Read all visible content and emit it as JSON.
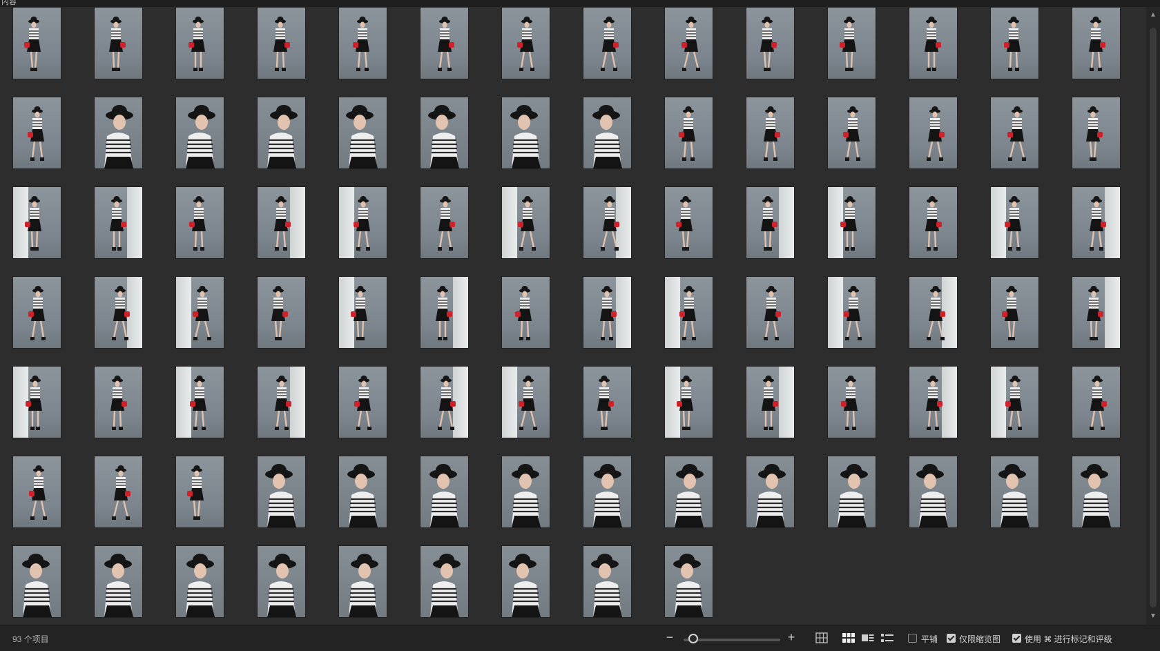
{
  "window": {
    "title": "内容"
  },
  "grid": {
    "item_count": 93,
    "columns": 14,
    "thumbnail_kind": "fashion photo — model in striped t-shirt, black skirt, black hat, red handbag"
  },
  "statusbar": {
    "count_label": "93 个项目",
    "zoom_minus": "−",
    "zoom_plus": "+",
    "zoom_level": 0.05,
    "view_modes": [
      "large-grid-icon",
      "grid-icon",
      "filmstrip-icon",
      "list-icon"
    ],
    "active_view": "grid-icon",
    "options": [
      {
        "label": "平铺",
        "checked": false
      },
      {
        "label": "仅限缩览图",
        "checked": true
      },
      {
        "label": "使用 ⌘ 进行标记和评级",
        "checked": true
      }
    ]
  },
  "colors": {
    "background": "#2d2d2d",
    "accent_bag": "#d0202a",
    "backdrop": "#7e878e"
  }
}
